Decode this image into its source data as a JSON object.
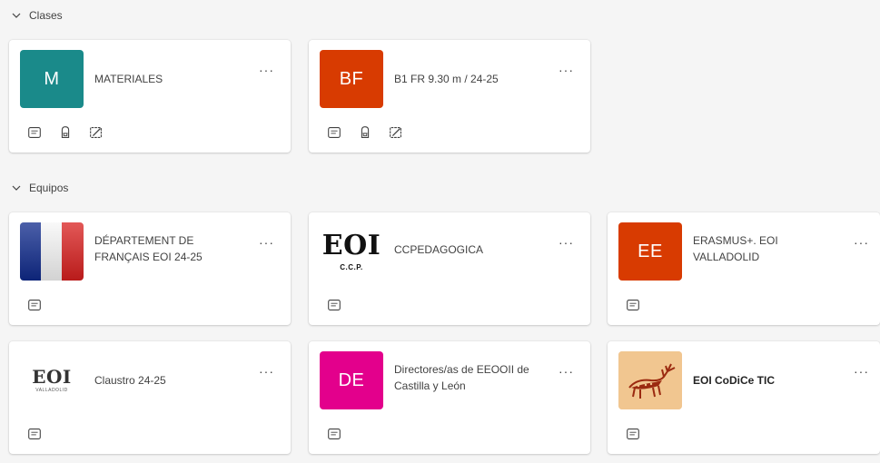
{
  "sections": {
    "clases": {
      "label": "Clases"
    },
    "equipos": {
      "label": "Equipos"
    }
  },
  "more_label": "···",
  "clases": [
    {
      "avatar": "M",
      "color": "#1a8a8a",
      "title": "MATERIALES"
    },
    {
      "avatar": "BF",
      "color": "#d83b01",
      "title": "B1 FR 9.30 m / 24-25"
    }
  ],
  "equipos": [
    {
      "avatar_type": "flag",
      "title": "DÉPARTEMENT DE FRANÇAIS EOI 24-25"
    },
    {
      "avatar_type": "logo-ccp",
      "logo_text": "EOI",
      "logo_sub": "C.C.P.",
      "title": "CCPEDAGOGICA"
    },
    {
      "avatar": "EE",
      "color": "#d83b01",
      "title": "ERASMUS+. EOI VALLADOLID"
    },
    {
      "avatar_type": "logo-claustro",
      "logo_text": "EOI",
      "logo_sub": "VALLADOLID",
      "title": "Claustro 24-25"
    },
    {
      "avatar": "DE",
      "color": "#e3008c",
      "title": "Directores/as de EEOOII de Castilla y León"
    },
    {
      "avatar_type": "deer",
      "title": "EOI CoDiCe TIC",
      "bold": true
    }
  ]
}
